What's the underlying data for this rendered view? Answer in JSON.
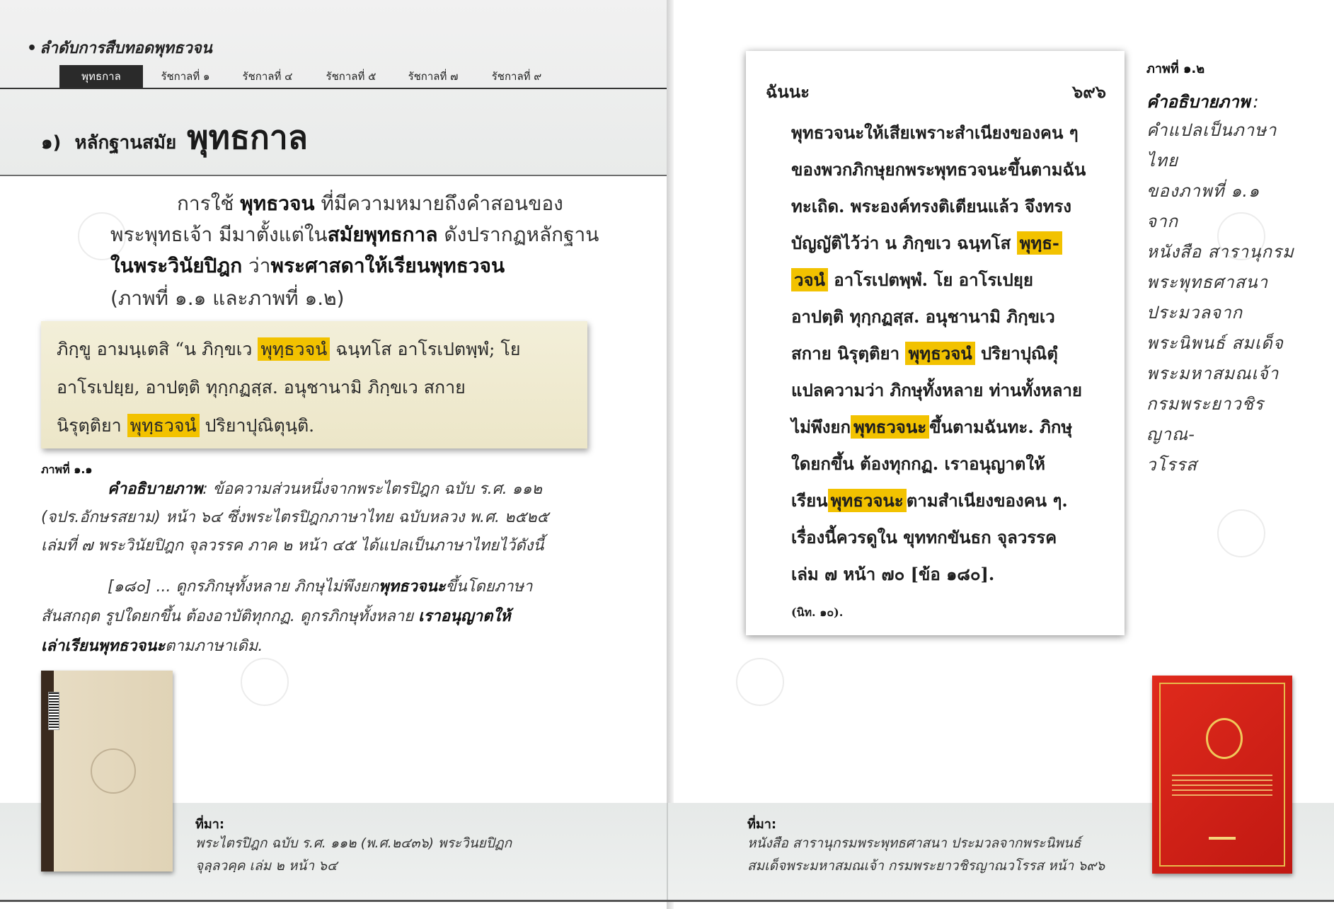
{
  "left_page": {
    "series_title": "ลำดับการสืบทอดพุทธวจน",
    "tabs": [
      {
        "label": "พุทธกาล",
        "active": true
      },
      {
        "label": "รัชกาลที่ ๑",
        "active": false
      },
      {
        "label": "รัชกาลที่ ๔",
        "active": false
      },
      {
        "label": "รัชกาลที่ ๕",
        "active": false
      },
      {
        "label": "รัชกาลที่ ๗",
        "active": false
      },
      {
        "label": "รัชกาลที่ ๙",
        "active": false
      }
    ],
    "section": {
      "number": "๑)",
      "title_prefix": "หลักฐานสมัย",
      "title_main": "พุทธกาล"
    },
    "intro": {
      "l1_a": "การใช้ ",
      "l1_b": "พุทธวจน",
      "l1_c": " ที่มีความหมายถึงคำสอนของ",
      "l2_a": "พระพุทธเจ้า มีมาตั้งแต่ใน",
      "l2_b": "สมัยพุทธกาล",
      "l2_c": " ดังปรากฏหลักฐาน",
      "l3_a": "ในพระวินัยปิฎก",
      "l3_b": " ว่า",
      "l3_c": "พระศาสดาให้เรียนพุทธวจน",
      "l4": "(ภาพที่ ๑.๑ และภาพที่ ๑.๒)"
    },
    "pali": {
      "l1_a": "ภิกฺขู  อามนฺเตสิ  “น  ภิกฺขเว ",
      "l1_hl": "พุทฺธวจนํ",
      "l1_b": " ฉนฺทโส  อาโรเปตพฺพํ;  โย",
      "l2": "อาโรเปยฺย,      อาปตฺติ      ทุกฺกฏสฺส.   อนุชานามิ    ภิกฺขเว      สกาย",
      "l3_a": "นิรุตฺติยา  ",
      "l3_hl": "พุทฺธวจนํ",
      "l3_b": "  ปริยาปุณิตุนฺติ."
    },
    "figure_1_1": {
      "label": "ภาพที่ ๑.๑",
      "caption_title": "คำอธิบายภาพ",
      "caption_l1": ": ข้อความส่วนหนึ่งจากพระไตรปิฎก ฉบับ ร.ศ. ๑๑๒",
      "caption_l2": "(จปร.อักษรสยาม) หน้า ๖๔ ซึ่งพระไตรปิฎกภาษาไทย ฉบับหลวง พ.ศ. ๒๕๒๕",
      "caption_l3": "เล่มที่ ๗ พระวินัยปิฎก จุลวรรค ภาค ๒   หน้า ๔๕ ได้แปลเป็นภาษาไทยไว้ดังนี้",
      "quote_l1_a": "[๑๘๐] ... ดูกรภิกษุทั้งหลาย ภิกษุไม่พึงยก",
      "quote_l1_b": "พุทธวจนะ",
      "quote_l1_c": "ขึ้นโดยภาษา",
      "quote_l2_a": "สันสกฤต รูปใดยกขึ้น ต้องอาบัติทุกกฏ.  ดูกรภิกษุทั้งหลาย ",
      "quote_l2_b": "เราอนุญาตให้",
      "quote_l3_a": "เล่าเรียนพุทธวจนะ",
      "quote_l3_b": "ตามภาษาเดิม."
    },
    "source": {
      "label": "ที่มา:",
      "l1": "พระไตรปิฎก ฉบับ ร.ศ. ๑๑๒ (พ.ศ.๒๔๓๖) พระวินยปิฏก",
      "l2": "จุลฺลวคฺค เล่ม ๒ หน้า ๖๔"
    }
  },
  "right_page": {
    "scan": {
      "head_left": "ฉันนะ",
      "head_right": "๖๙๖",
      "lines": [
        {
          "a": "พุทธวจนะให้เสียเพราะสำเนียงของคน  ๆ"
        },
        {
          "a": "ของพวกภิกษุยกพระพุทธวจนะขึ้นตามฉัน"
        },
        {
          "a": "ทะเถิด.  พระองค์ทรงติเตียนแล้ว  จึงทรง"
        },
        {
          "a": "บัญญัติไว้ว่า  น  ภิกฺขเว  ฉนฺทโส  ",
          "hl": "พุทฺธ-"
        },
        {
          "hl": "วจนํ",
          "b": "  อาโรเปตพฺพํ.   โย   อาโรเปยฺย"
        },
        {
          "a": "อาปตฺติ  ทุกฺกฏสฺส.  อนุชานามิ  ภิกฺขเว"
        },
        {
          "a": "สกาย  นิรุตฺติยา  ",
          "hl": "พุทฺธวจนํ",
          "b": "  ปริยาปุณิตุํ"
        },
        {
          "a": "แปลความว่า  ภิกษุทั้งหลาย  ท่านทั้งหลาย"
        },
        {
          "a": "ไม่พึงยก",
          "hl": "พุทธวจนะ",
          "b": "ขึ้นตามฉันทะ.   ภิกษุ"
        },
        {
          "a": "ใดยกขึ้น     ต้องทุกกฏ.     เราอนุญาตให้"
        },
        {
          "a": "เรียน",
          "hl": "พุทธวจนะ",
          "b": "ตามสำเนียงของคน   ๆ."
        },
        {
          "a": "เรื่องนี้ควรดูใน    ขุททกขันธก   จุลวรรค"
        },
        {
          "a": "เล่ม  ๗       หน้า  ๗๐       [ข้อ  ๑๘๐]."
        }
      ],
      "foot": "(นิท. ๑๐)."
    },
    "figure_1_2": {
      "label": "ภาพที่ ๑.๒",
      "caption_title": "คำอธิบายภาพ",
      "caption_title_colon": ":",
      "caption_lines": [
        "คำแปลเป็นภาษาไทย",
        "ของภาพที่ ๑.๑ จาก",
        "หนังสือ สารานุกรม",
        "พระพุทธศาสนา",
        "ประมวลจาก",
        "พระนิพนธ์ สมเด็จ",
        "พระมหาสมณเจ้า",
        "กรมพระยาวชิรญาณ-",
        "วโรรส"
      ]
    },
    "source": {
      "label": "ที่มา:",
      "l1": "หนังสือ สารานุกรมพระพุทธศาสนา ประมวลจากพระนิพนธ์",
      "l2": "สมเด็จพระมหาสมณเจ้า กรมพระยาวชิรญาณวโรรส หน้า ๖๙๖"
    }
  },
  "colors": {
    "highlight": "#f2c200",
    "tab_active_bg": "#2a2a2a",
    "book_cover_red": "#d21f16",
    "scan_paper": "#ffffff",
    "pali_paper": "#efe9cd"
  }
}
